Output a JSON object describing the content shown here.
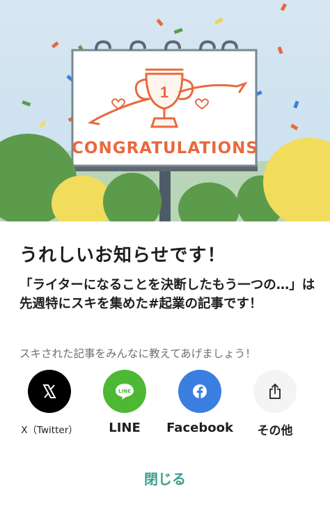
{
  "hero": {
    "sign_text": "CONGRATULATIONS",
    "trophy_number": "1",
    "colors": {
      "sky": "#cfe2ef",
      "orange": "#e8693d",
      "green": "#5c9b4c",
      "yellow": "#f1dc5c"
    }
  },
  "modal": {
    "title": "うれしいお知らせです！",
    "description": "「ライターになることを決断したもう一つの…」は先週特にスキを集めた#起業の記事です！",
    "share_prompt": "スキされた記事をみんなに教えてあげましょう！",
    "share_buttons": [
      {
        "label": "X（Twitter）",
        "icon": "x-logo-icon",
        "color": "#000000"
      },
      {
        "label": "LINE",
        "icon": "line-icon",
        "color": "#4cb833"
      },
      {
        "label": "Facebook",
        "icon": "facebook-icon",
        "color": "#3a7ee0"
      },
      {
        "label": "その他",
        "icon": "share-icon",
        "color": "#f4f4f4"
      }
    ],
    "close_label": "閉じる"
  }
}
